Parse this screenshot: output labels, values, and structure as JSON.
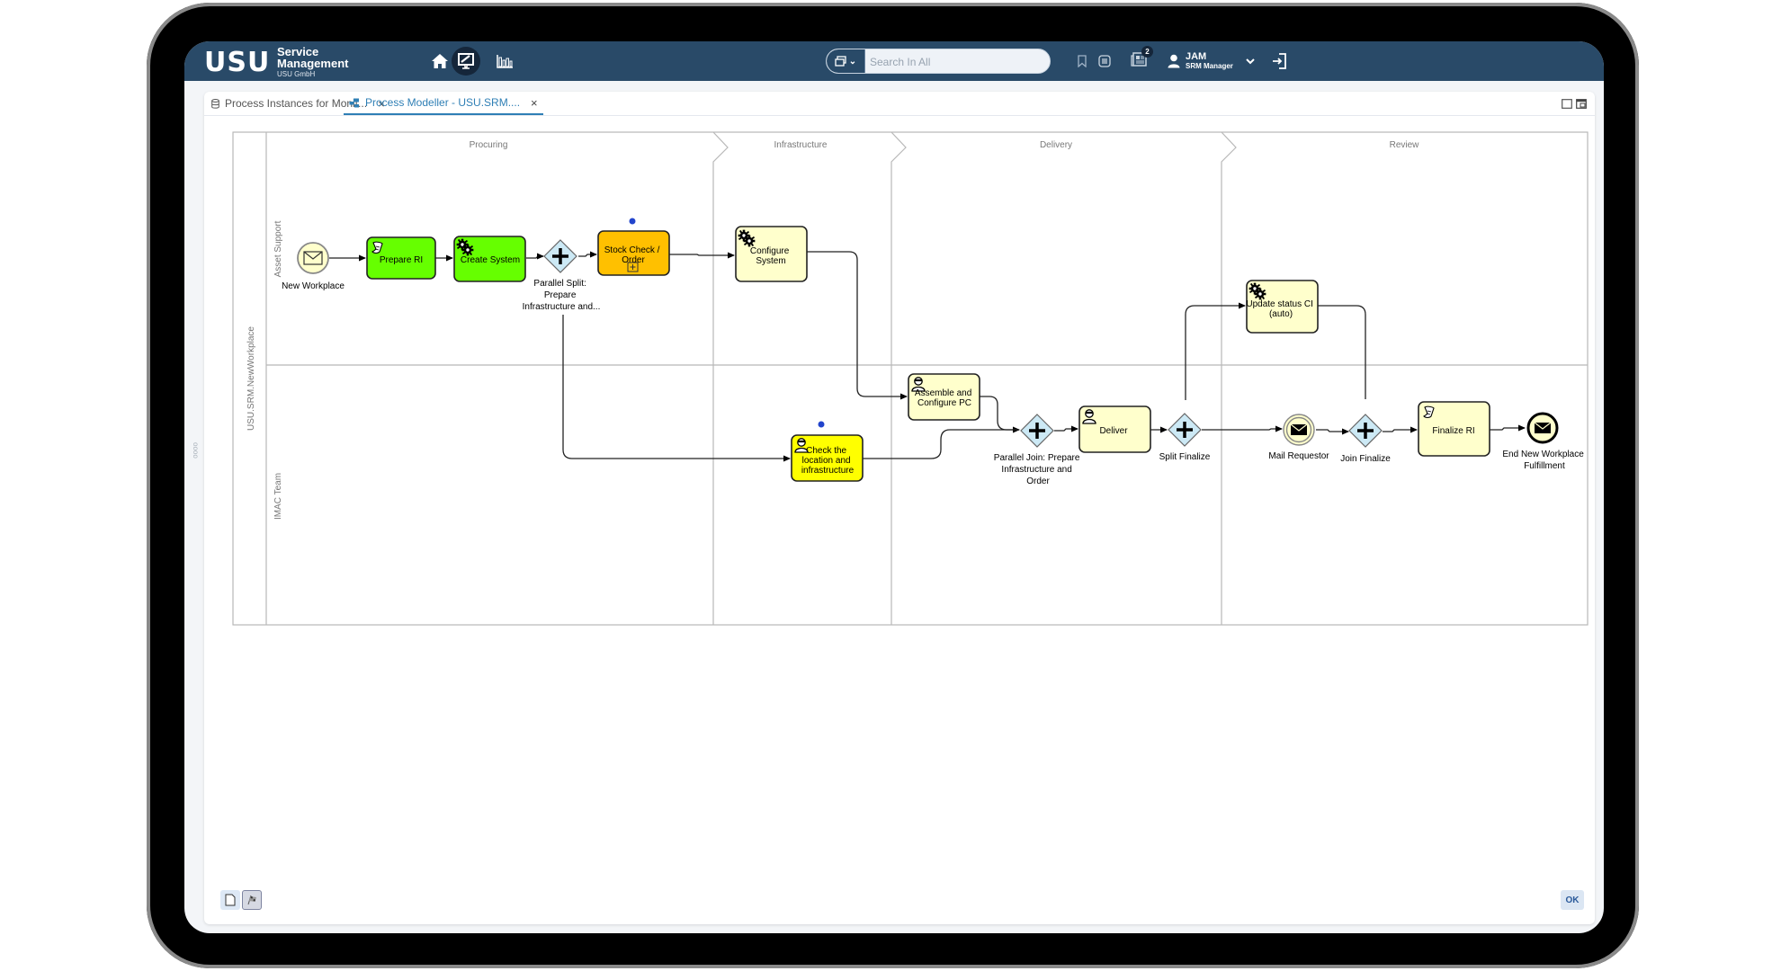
{
  "header": {
    "logo": "USU",
    "app_name_line1": "Service",
    "app_name_line2": "Management",
    "company": "USU GmbH",
    "nav": [
      {
        "name": "home",
        "icon": "home-icon"
      },
      {
        "name": "workplace",
        "icon": "monitor-brush-icon",
        "active": true
      },
      {
        "name": "reports",
        "icon": "bar-chart-icon"
      }
    ],
    "search": {
      "placeholder": "Search In All",
      "value": "",
      "scope_icon": "window-stack-icon"
    },
    "notifications_count": "2",
    "user": {
      "name": "JAM",
      "role": "SRM Manager"
    }
  },
  "tabs": [
    {
      "label": "Process Instances for Monit...",
      "icon": "database-icon",
      "active": false
    },
    {
      "label": "Process Modeller - USU.SRM....",
      "icon": "process-model-icon",
      "active": true
    }
  ],
  "diagram": {
    "pool_label": "USU.SRM.NewWorkplace",
    "lanes": [
      "Asset Support",
      "IMAC Team"
    ],
    "phases": [
      "Procuring",
      "Infrastructure",
      "Delivery",
      "Review"
    ],
    "nodes": {
      "start": {
        "label": "New Workplace",
        "type": "message-start-event"
      },
      "prepare_ri": {
        "label": "Prepare RI",
        "type": "script-task",
        "status": "completed",
        "color": "#66ff00"
      },
      "create_system": {
        "label": "Create System",
        "type": "service-task",
        "status": "completed",
        "color": "#66ff00"
      },
      "parallel_split": {
        "label_lines": [
          "Parallel Split:",
          "Prepare",
          "Infrastructure and..."
        ],
        "type": "parallel-gateway"
      },
      "stock_check": {
        "label_lines": [
          "Stock Check /",
          "Order"
        ],
        "type": "subprocess",
        "status": "active",
        "color": "#ffc000"
      },
      "configure_system": {
        "label_lines": [
          "Configure",
          "System"
        ],
        "type": "service-task",
        "color": "#ffffcc"
      },
      "check_location": {
        "label_lines": [
          "Check the",
          "location and",
          "infrastructure"
        ],
        "type": "user-task",
        "status": "active",
        "color": "#ffff00"
      },
      "assemble": {
        "label_lines": [
          "Assemble and",
          "Configure PC"
        ],
        "type": "user-task",
        "color": "#ffffcc"
      },
      "parallel_join": {
        "label_lines": [
          "Parallel Join: Prepare",
          "Infrastructure and",
          "Order"
        ],
        "type": "parallel-gateway"
      },
      "deliver": {
        "label": "Deliver",
        "type": "user-task",
        "color": "#ffffcc"
      },
      "split_finalize": {
        "label": "Split Finalize",
        "type": "parallel-gateway"
      },
      "update_status": {
        "label_lines": [
          "Update status CI",
          "(auto)"
        ],
        "type": "service-task",
        "color": "#ffffcc"
      },
      "mail_requestor": {
        "label": "Mail Requestor",
        "type": "message-intermediate-event"
      },
      "join_finalize": {
        "label": "Join Finalize",
        "type": "parallel-gateway"
      },
      "finalize_ri": {
        "label": "Finalize RI",
        "type": "script-task",
        "color": "#ffffcc"
      },
      "end": {
        "label_lines": [
          "End New Workplace",
          "Fulfillment"
        ],
        "type": "message-end-event"
      }
    }
  },
  "footer": {
    "ok_label": "OK"
  },
  "colors": {
    "header_bg": "#294a68",
    "tab_active": "#2f7fb5",
    "completed": "#66ff00",
    "active_task": "#ffc000",
    "active_user_task": "#ffff00",
    "pending": "#ffffcc",
    "gateway": "#cce9f5"
  }
}
